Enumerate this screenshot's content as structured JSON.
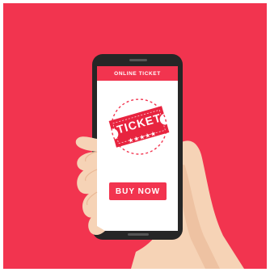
{
  "screen": {
    "header_label": "ONLINE TICKET",
    "ticket_label": "TICKET",
    "buy_label": "BUY NOW"
  },
  "icons": [
    "ticket-icon",
    "star-icon",
    "smartphone-icon",
    "hand-icon"
  ],
  "colors": {
    "background": "#f2344f",
    "phone_body": "#262626",
    "screen": "#ffffff",
    "ticket": "#e8243f",
    "skin": "#f6d3b6",
    "skin_shadow": "#eab895"
  }
}
